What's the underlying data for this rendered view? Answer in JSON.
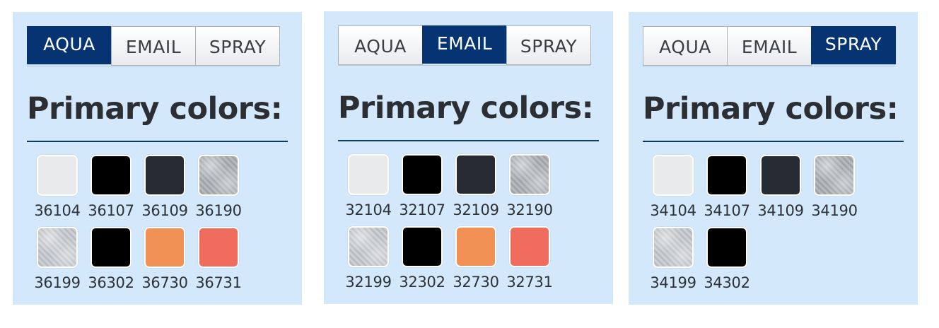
{
  "panels": [
    {
      "tabs": [
        {
          "label": "AQUA",
          "active": true
        },
        {
          "label": "EMAIL",
          "active": false
        },
        {
          "label": "SPRAY",
          "active": false
        }
      ],
      "heading": "Primary colors:",
      "swatches": [
        {
          "code": "36104",
          "color": "#e9eaec",
          "finish": "solid"
        },
        {
          "code": "36107",
          "color": "#000000",
          "finish": "solid"
        },
        {
          "code": "36109",
          "color": "#262b33",
          "finish": "solid"
        },
        {
          "code": "36190",
          "color": "#a9adb3",
          "finish": "metal"
        },
        {
          "code": "36199",
          "color": "#c3c7cc",
          "finish": "metal"
        },
        {
          "code": "36302",
          "color": "#000000",
          "finish": "solid"
        },
        {
          "code": "36730",
          "color": "#f29156",
          "finish": "solid"
        },
        {
          "code": "36731",
          "color": "#f06c5e",
          "finish": "solid"
        }
      ]
    },
    {
      "tabs": [
        {
          "label": "AQUA",
          "active": false
        },
        {
          "label": "EMAIL",
          "active": true
        },
        {
          "label": "SPRAY",
          "active": false
        }
      ],
      "heading": "Primary colors:",
      "swatches": [
        {
          "code": "32104",
          "color": "#e9eaec",
          "finish": "solid"
        },
        {
          "code": "32107",
          "color": "#000000",
          "finish": "solid"
        },
        {
          "code": "32109",
          "color": "#262b33",
          "finish": "solid"
        },
        {
          "code": "32190",
          "color": "#a9adb3",
          "finish": "metal"
        },
        {
          "code": "32199",
          "color": "#c3c7cc",
          "finish": "metal"
        },
        {
          "code": "32302",
          "color": "#000000",
          "finish": "solid"
        },
        {
          "code": "32730",
          "color": "#f29156",
          "finish": "solid"
        },
        {
          "code": "32731",
          "color": "#f06c5e",
          "finish": "solid"
        }
      ]
    },
    {
      "tabs": [
        {
          "label": "AQUA",
          "active": false
        },
        {
          "label": "EMAIL",
          "active": false
        },
        {
          "label": "SPRAY",
          "active": true
        }
      ],
      "heading": "Primary colors:",
      "swatches": [
        {
          "code": "34104",
          "color": "#e9eaec",
          "finish": "solid"
        },
        {
          "code": "34107",
          "color": "#000000",
          "finish": "solid"
        },
        {
          "code": "34109",
          "color": "#262b33",
          "finish": "solid"
        },
        {
          "code": "34190",
          "color": "#a9adb3",
          "finish": "metal"
        },
        {
          "code": "34199",
          "color": "#c3c7cc",
          "finish": "metal"
        },
        {
          "code": "34302",
          "color": "#000000",
          "finish": "solid"
        }
      ]
    }
  ],
  "colors": {
    "panel_background": "#d4e8fb",
    "active_tab": "#063472",
    "rule": "#0f3a66",
    "text": "#2b2f33"
  }
}
